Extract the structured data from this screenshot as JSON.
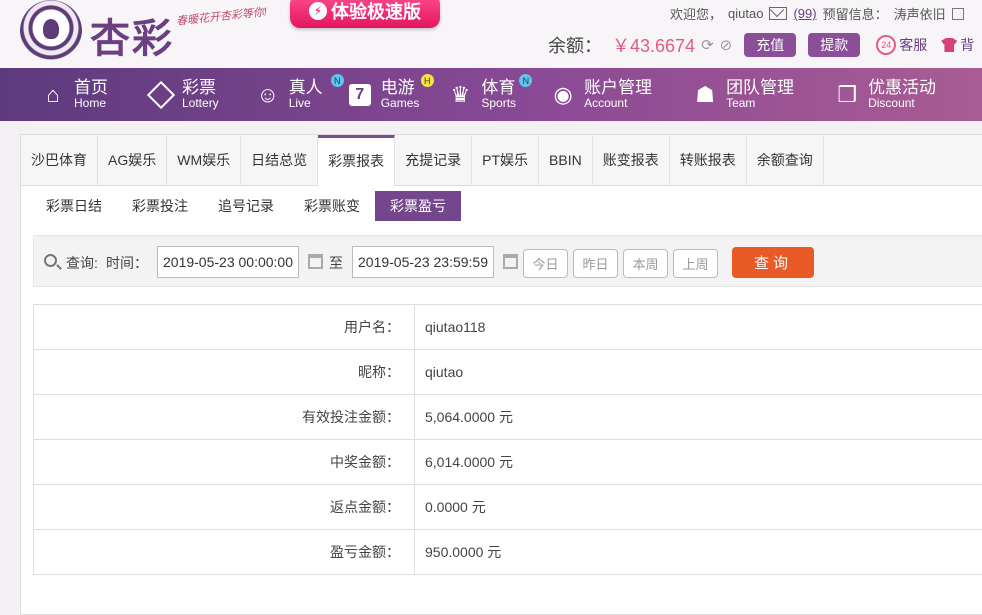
{
  "header": {
    "logo_text": "杏彩",
    "slogan": "春暖花开杏彩等你!",
    "promo_label": "体验极速版",
    "welcome_label": "欢迎您，",
    "username": "qiutao",
    "message_count": "(99)",
    "reserved_info_label": "预留信息：",
    "reserved_info": "涛声依旧",
    "balance_label": "余额：",
    "balance_value": "￥43.6674",
    "recharge_label": "充值",
    "withdraw_label": "提款",
    "service_label": "客服",
    "service_badge": "24",
    "extra_label": "背"
  },
  "nav": {
    "items": [
      {
        "zh": "首页",
        "en": "Home",
        "icon": "home-icon"
      },
      {
        "zh": "彩票",
        "en": "Lottery",
        "icon": "lottery-icon"
      },
      {
        "zh": "真人",
        "en": "Live",
        "icon": "live-icon",
        "badge": "N"
      },
      {
        "zh": "电游",
        "en": "Games",
        "icon": "games-icon",
        "badge": "H"
      },
      {
        "zh": "体育",
        "en": "Sports",
        "icon": "trophy-icon",
        "badge": "N"
      },
      {
        "zh": "账户管理",
        "en": "Account",
        "icon": "account-icon"
      },
      {
        "zh": "团队管理",
        "en": "Team",
        "icon": "team-icon"
      },
      {
        "zh": "优惠活动",
        "en": "Discount",
        "icon": "gift-icon"
      }
    ]
  },
  "tabs": [
    "沙巴体育",
    "AG娱乐",
    "WM娱乐",
    "日结总览",
    "彩票报表",
    "充提记录",
    "PT娱乐",
    "BBIN",
    "账变报表",
    "转账报表",
    "余额查询"
  ],
  "active_tab": "彩票报表",
  "subtabs": [
    "彩票日结",
    "彩票投注",
    "追号记录",
    "彩票账变",
    "彩票盈亏"
  ],
  "active_subtab": "彩票盈亏",
  "query": {
    "label": "查询:",
    "time_label": "时间：",
    "start_time": "2019-05-23 00:00:00",
    "to_label": "至",
    "end_time": "2019-05-23 23:59:59",
    "today": "今日",
    "yesterday": "昨日",
    "this_week": "本周",
    "last_week": "上周",
    "search_label": "查询"
  },
  "report": {
    "rows": [
      {
        "label": "用户名：",
        "value": "qiutao118"
      },
      {
        "label": "昵称：",
        "value": "qiutao"
      },
      {
        "label": "有效投注金额：",
        "value": "5,064.0000 元"
      },
      {
        "label": "中奖金额：",
        "value": "6,014.0000 元"
      },
      {
        "label": "返点金额：",
        "value": "0.0000 元"
      },
      {
        "label": "盈亏金额：",
        "value": "950.0000 元"
      }
    ]
  },
  "colors": {
    "brand_purple": "#74478c",
    "accent_pink": "#e35b7e",
    "search_orange": "#ea5a27"
  }
}
